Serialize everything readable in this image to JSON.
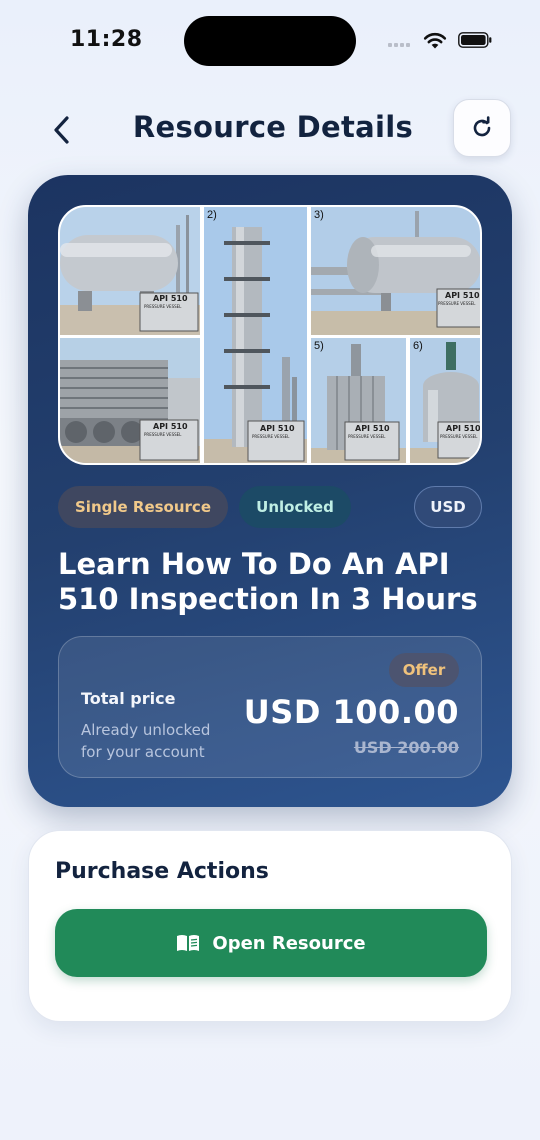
{
  "status": {
    "time": "11:28"
  },
  "header": {
    "title": "Resource Details",
    "back_icon": "chevron-left-icon",
    "refresh_icon": "refresh-icon"
  },
  "hero": {
    "gallery": {
      "tiles": [
        {
          "number": "",
          "plate": "API 510",
          "plate_sub": "PRESSURE VESSEL"
        },
        {
          "number": "",
          "plate": "API 510",
          "plate_sub": "PRESSURE VESSEL"
        },
        {
          "number": "2)",
          "plate": "API 510",
          "plate_sub": "PRESSURE VESSEL"
        },
        {
          "number": "3)",
          "plate": "API 510",
          "plate_sub": "PRESSURE VESSEL"
        },
        {
          "number": "5)",
          "plate": "API 510",
          "plate_sub": "PRESSURE VESSEL"
        },
        {
          "number": "6)",
          "plate": "API 510",
          "plate_sub": "PRESSURE VESSEL"
        }
      ]
    },
    "chips": {
      "type": "Single Resource",
      "status": "Unlocked",
      "currency": "USD"
    },
    "title": "Learn How To Do An API 510 Inspection In 3 Hours",
    "price": {
      "offer_label": "Offer",
      "total_label": "Total price",
      "note": "Already unlocked for your account",
      "current": "USD 100.00",
      "original": "USD 200.00"
    }
  },
  "actions": {
    "title": "Purchase Actions",
    "open_button": "Open Resource",
    "open_icon": "book-icon"
  },
  "colors": {
    "accent_green": "#218a59",
    "hero_navy": "#1c3461",
    "offer_gold": "#f0c27c"
  }
}
